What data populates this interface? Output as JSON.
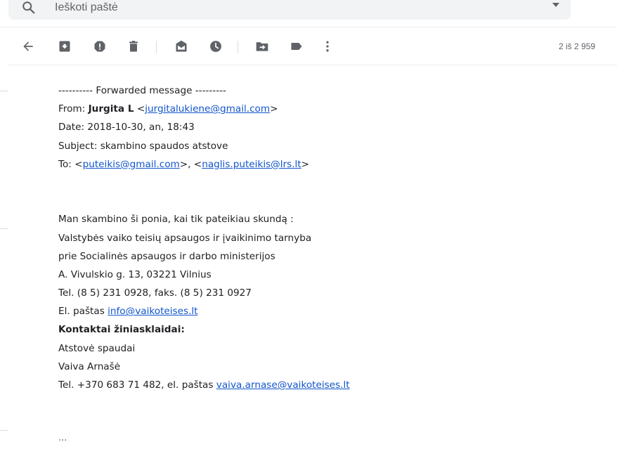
{
  "search": {
    "placeholder": "Ieškoti paštė"
  },
  "toolbar": {
    "icons": [
      "back-arrow-icon",
      "archive-icon",
      "report-spam-icon",
      "delete-icon",
      "mark-unread-icon",
      "snooze-icon",
      "move-to-icon",
      "label-icon",
      "more-vert-icon"
    ],
    "pager": "2 iš 2 959"
  },
  "message": {
    "forward_header": "---------- Forwarded message ---------",
    "from_label": "From: ",
    "from_name": "Jurgita L",
    "from_open": " <",
    "from_email": "jurgitalukiene@gmail.com",
    "from_close": ">",
    "date": "Date: 2018-10-30, an, 18:43",
    "subject": "Subject: skambino spaudos atstove",
    "to_label": "To: <",
    "to_email1": "puteikis@gmail.com",
    "to_mid": ">, <",
    "to_email2": "naglis.puteikis@lrs.lt",
    "to_close": ">",
    "body_line1": "Man skambino ši ponia, kai tik pateikiau skundą :",
    "body_line2": "Valstybės vaiko teisių apsaugos ir įvaikinimo tarnyba",
    "body_line3": "prie Socialinės apsaugos ir darbo ministerijos",
    "body_line4": "A. Vivulskio g. 13, 03221 Vilnius",
    "body_line5": "Tel. (8 5) 231 0928, faks. (8 5) 231 0927",
    "email_label": "El. paštas ",
    "email_link": "info@vaikoteises.lt",
    "contacts_heading": "Kontaktai žiniasklaidai:",
    "press_role": "Atstovė spaudai",
    "press_name": "Vaiva Arnašė",
    "press_contact": "Tel. +370 683 71 482, el. paštas ",
    "press_email": "vaiva.arnase@vaikoteises.lt",
    "ellipsis": "..."
  },
  "colors": {
    "link": "#1155cc",
    "icon": "#5f6368",
    "text": "#202124"
  }
}
